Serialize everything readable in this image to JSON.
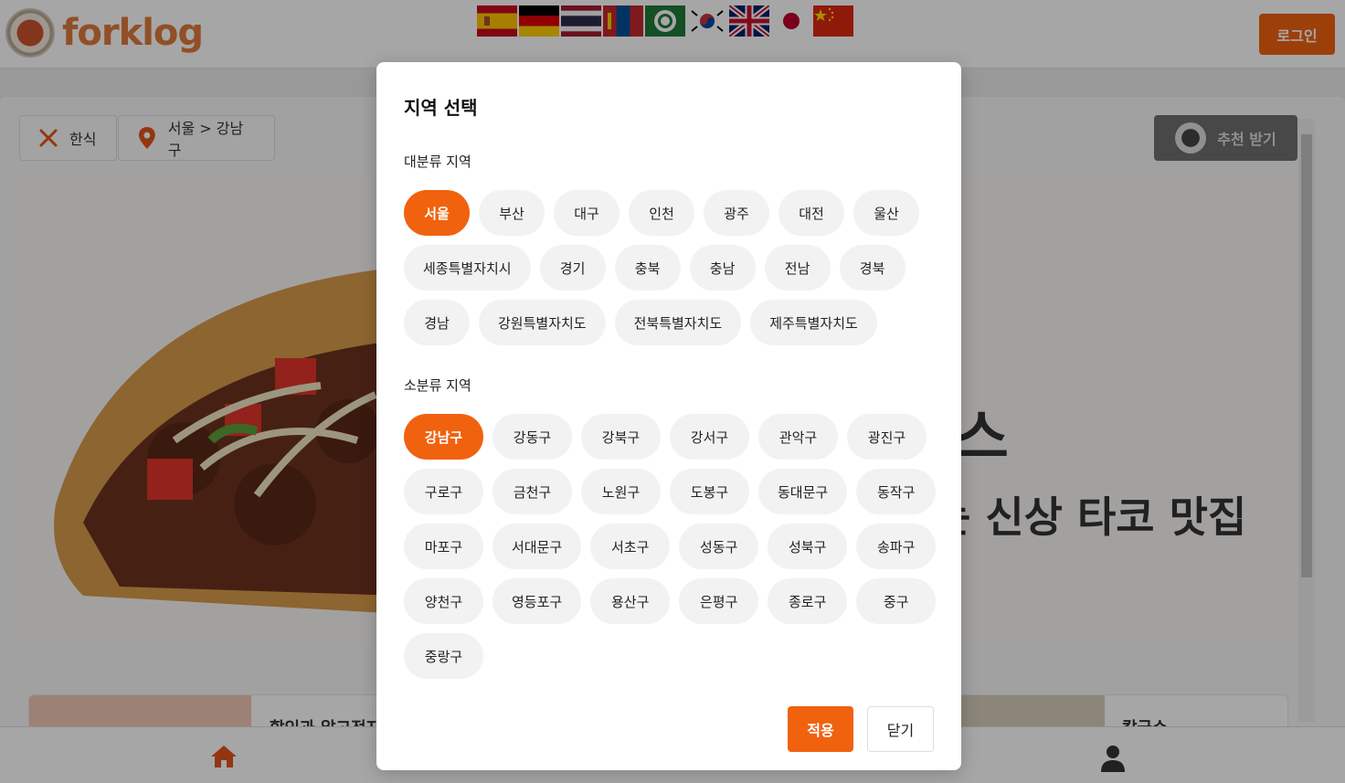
{
  "header": {
    "logo_text": "forklog",
    "flags": [
      "spain-flag",
      "germany-flag",
      "thailand-flag",
      "mongolia-flag",
      "arabic-flag",
      "korea-flag",
      "uk-flag",
      "japan-flag",
      "china-flag"
    ],
    "login_label": "로그인"
  },
  "filters": {
    "food_label": "한식",
    "region_label": "서울 > 강남구",
    "recommend_label": "추천 받기"
  },
  "banner": {
    "headline_fragment": "스",
    "subline_fragment": "는 신상 타코 맛집"
  },
  "cards": {
    "left_title": "할인과 알고전지",
    "right_title": "칼국수"
  },
  "modal": {
    "title": "지역 선택",
    "major_label": "대분류 지역",
    "major_regions": [
      "서울",
      "부산",
      "대구",
      "인천",
      "광주",
      "대전",
      "울산",
      "세종특별자치시",
      "경기",
      "충북",
      "충남",
      "전남",
      "경북",
      "경남",
      "강원특별자치도",
      "전북특별자치도",
      "제주특별자치도"
    ],
    "major_selected": "서울",
    "minor_label": "소분류 지역",
    "minor_regions": [
      "강남구",
      "강동구",
      "강북구",
      "강서구",
      "관악구",
      "광진구",
      "구로구",
      "금천구",
      "노원구",
      "도봉구",
      "동대문구",
      "동작구",
      "마포구",
      "서대문구",
      "서초구",
      "성동구",
      "성북구",
      "송파구",
      "양천구",
      "영등포구",
      "용산구",
      "은평구",
      "종로구",
      "중구",
      "중랑구"
    ],
    "minor_selected": "강남구",
    "apply_label": "적용",
    "close_label": "닫기"
  },
  "colors": {
    "accent": "#f0620e"
  }
}
